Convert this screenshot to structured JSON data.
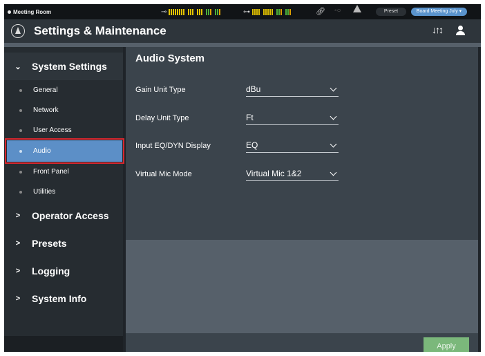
{
  "status": {
    "room": "Meeting Room",
    "preset_label": "Preset",
    "board_label": "Board Meeting July ▾"
  },
  "header": {
    "title": "Settings & Maintenance"
  },
  "sidebar": {
    "system_settings": "System Settings",
    "sub_items": [
      "General",
      "Network",
      "User Access",
      "Audio",
      "Front Panel",
      "Utilities"
    ],
    "active_item": "Audio",
    "sections": [
      "Operator Access",
      "Presets",
      "Logging",
      "System Info"
    ]
  },
  "main": {
    "title": "Audio System",
    "rows": [
      {
        "label": "Gain Unit Type",
        "value": "dBu"
      },
      {
        "label": "Delay Unit Type",
        "value": "Ft"
      },
      {
        "label": "Input EQ/DYN Display",
        "value": "EQ"
      },
      {
        "label": "Virtual Mic Mode",
        "value": "Virtual Mic 1&2"
      }
    ],
    "apply_label": "Apply"
  },
  "colors": {
    "accent": "#5c8fc7",
    "highlight_outline": "#d8262e",
    "apply_button": "#7bb87b"
  }
}
